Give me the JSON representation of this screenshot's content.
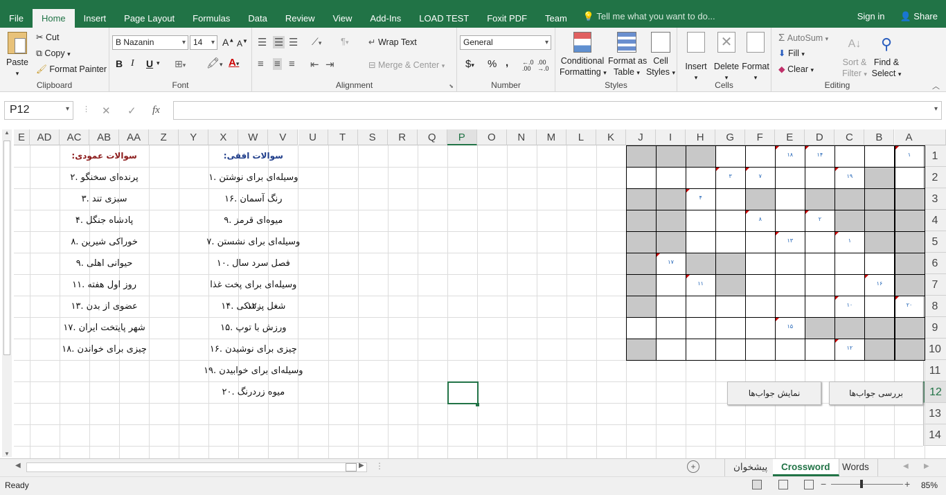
{
  "window": {
    "title": "Book1 (Recovered) (Recovered).xlsm - Excel"
  },
  "tabs": [
    "File",
    "Home",
    "Insert",
    "Page Layout",
    "Formulas",
    "Data",
    "Review",
    "View",
    "Add-Ins",
    "LOAD TEST",
    "Foxit PDF",
    "Team"
  ],
  "tell_me": "Tell me what you want to do...",
  "sign_in": "Sign in",
  "share": "Share",
  "clipboard": {
    "paste": "Paste",
    "cut": "Cut",
    "copy": "Copy",
    "format_painter": "Format Painter",
    "label": "Clipboard"
  },
  "font": {
    "name": "B Nazanin",
    "size": "14",
    "bold": "B",
    "italic": "I",
    "underline": "U",
    "label": "Font"
  },
  "alignment": {
    "wrap": "Wrap Text",
    "merge": "Merge & Center",
    "label": "Alignment"
  },
  "number": {
    "format": "General",
    "currency": "$",
    "percent": "%",
    "comma": ",",
    "label": "Number"
  },
  "styles": {
    "conditional": "Conditional",
    "conditional2": "Formatting",
    "format_as": "Format as",
    "format_as2": "Table",
    "cell": "Cell",
    "cell2": "Styles",
    "label": "Styles"
  },
  "cells": {
    "insert": "Insert",
    "delete": "Delete",
    "format": "Format",
    "label": "Cells"
  },
  "editing": {
    "autosum": "AutoSum",
    "fill": "Fill",
    "clear": "Clear",
    "sort": "Sort &",
    "sort2": "Filter",
    "find": "Find &",
    "find2": "Select",
    "label": "Editing"
  },
  "formula_bar": {
    "name_box": "P12",
    "value": ""
  },
  "columns": [
    "E",
    "AD",
    "AC",
    "AB",
    "AA",
    "Z",
    "Y",
    "X",
    "W",
    "V",
    "U",
    "T",
    "S",
    "R",
    "Q",
    "P",
    "O",
    "N",
    "M",
    "L",
    "K",
    "J",
    "I",
    "H",
    "G",
    "F",
    "E",
    "D",
    "C",
    "B",
    "A"
  ],
  "rows": [
    "1",
    "2",
    "3",
    "4",
    "5",
    "6",
    "7",
    "8",
    "9",
    "10",
    "11",
    "12",
    "13",
    "14"
  ],
  "horizontal_title": "سوالات افقی:",
  "horizontal_questions": [
    "وسیله‌ای برای نوشتن .۱",
    "رنگ آسمان .۱۶",
    "میوه‌ای قرمز .۹",
    "وسیله‌ای برای نشستن .۷",
    "فصل سرد سال .۱۰",
    "وسیله‌ای برای پخت غذا .۱۲",
    "شغل پزشکی .۱۴",
    "ورزش با توپ .۱۵",
    "چیزی برای نوشیدن .۱۶",
    "وسیله‌ای برای خوابیدن .۱۹",
    "میوه زردرنگ .۲۰"
  ],
  "vertical_title": "سوالات عمودی:",
  "vertical_questions": [
    "پرنده‌ای سخنگو .۲",
    "سبزی تند .۳",
    "پادشاه جنگل .۴",
    "خوراکی شیرین .۸",
    "حیوانی اهلی .۹",
    "روز اول هفته .۱۱",
    "عضوی از بدن .۱۳",
    "شهر پایتخت ایران .۱۷",
    "چیزی برای خواندن .۱۸"
  ],
  "crossword": {
    "numbers": [
      {
        "row": 1,
        "col": "A",
        "label": "۱"
      },
      {
        "row": 1,
        "col": "D",
        "label": "۱۴"
      },
      {
        "row": 1,
        "col": "E",
        "label": "۱۸"
      },
      {
        "row": 2,
        "col": "C",
        "label": "۱۹"
      },
      {
        "row": 2,
        "col": "F",
        "label": "۷"
      },
      {
        "row": 2,
        "col": "G",
        "label": "۳"
      },
      {
        "row": 3,
        "col": "H",
        "label": "۴"
      },
      {
        "row": 4,
        "col": "D",
        "label": "۲"
      },
      {
        "row": 4,
        "col": "F",
        "label": "۸"
      },
      {
        "row": 5,
        "col": "C",
        "label": "۱"
      },
      {
        "row": 5,
        "col": "E",
        "label": "۱۳"
      },
      {
        "row": 6,
        "col": "I",
        "label": "۱۷"
      },
      {
        "row": 7,
        "col": "B",
        "label": "۱۶"
      },
      {
        "row": 7,
        "col": "H",
        "label": "۱۱"
      },
      {
        "row": 8,
        "col": "A",
        "label": "۲۰"
      },
      {
        "row": 8,
        "col": "C",
        "label": "۱۰"
      },
      {
        "row": 9,
        "col": "E",
        "label": "۱۵"
      },
      {
        "row": 10,
        "col": "C",
        "label": "۱۲"
      }
    ]
  },
  "buttons": {
    "check": "بررسی جواب‌ها",
    "show": "نمایش جواب‌ها"
  },
  "sheet_tabs": [
    "پیشخوان",
    "Crossword",
    "Words"
  ],
  "status": {
    "ready": "Ready",
    "zoom": "85%"
  }
}
